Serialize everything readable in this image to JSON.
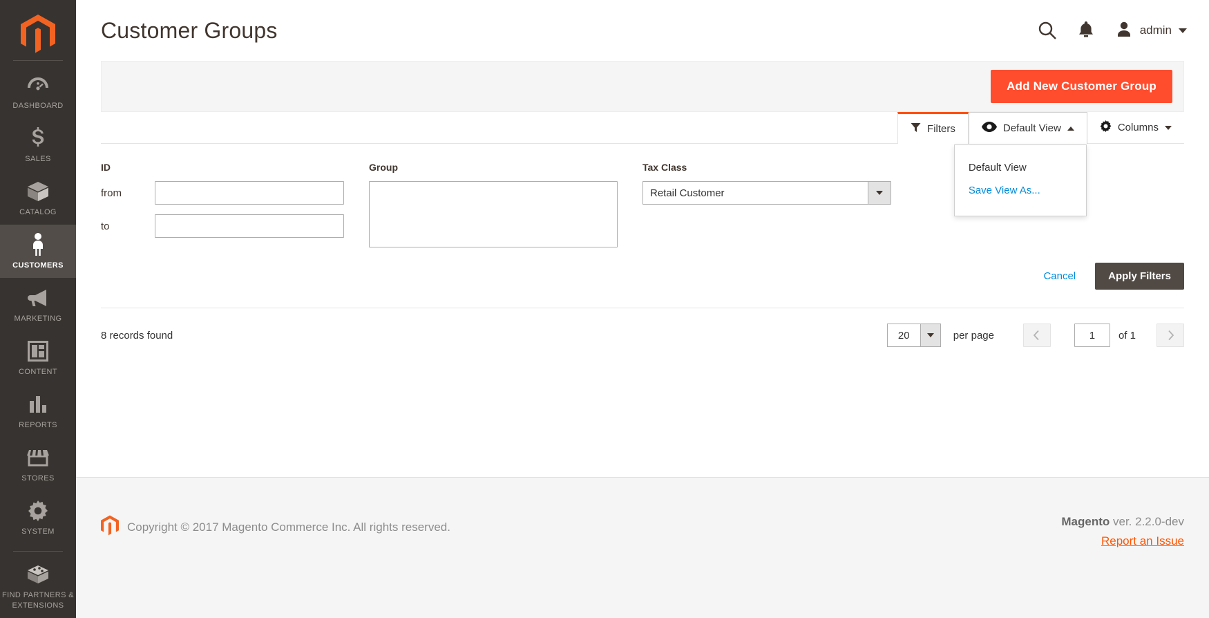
{
  "colors": {
    "accent_orange": "#ff4d2e",
    "sidebar_bg": "#373330",
    "link_blue": "#008bdb",
    "dark_button": "#514943",
    "active_tab_border": "#ff5003",
    "footer_link": "#ff5501"
  },
  "sidebar": {
    "logo_name": "magento-logo-icon",
    "items": [
      {
        "label": "DASHBOARD",
        "icon": "dashboard-gauge-icon",
        "active": false
      },
      {
        "label": "SALES",
        "icon": "dollar-sign-icon",
        "active": false
      },
      {
        "label": "CATALOG",
        "icon": "box-icon",
        "active": false
      },
      {
        "label": "CUSTOMERS",
        "icon": "person-icon",
        "active": true
      },
      {
        "label": "MARKETING",
        "icon": "megaphone-icon",
        "active": false
      },
      {
        "label": "CONTENT",
        "icon": "layout-page-icon",
        "active": false
      },
      {
        "label": "REPORTS",
        "icon": "bar-chart-icon",
        "active": false
      },
      {
        "label": "STORES",
        "icon": "storefront-icon",
        "active": false
      },
      {
        "label": "SYSTEM",
        "icon": "gear-icon",
        "active": false
      },
      {
        "label": "FIND PARTNERS & EXTENSIONS",
        "icon": "puzzle-box-icon",
        "active": false
      }
    ]
  },
  "header": {
    "title": "Customer Groups",
    "search_icon": "search-icon",
    "notifications_icon": "bell-icon",
    "avatar_icon": "user-avatar-icon",
    "admin_name": "admin",
    "caret_icon": "chevron-down-icon"
  },
  "page_actions": {
    "add_button_label": "Add New Customer Group"
  },
  "toolbar": {
    "filters": {
      "label": "Filters",
      "icon": "filter-funnel-icon",
      "active": true
    },
    "view": {
      "label": "Default View",
      "icon": "eye-icon",
      "caret": "chevron-up-icon",
      "expanded": true,
      "options": [
        {
          "label": "Default View",
          "type": "option"
        },
        {
          "label": "Save View As...",
          "type": "link"
        }
      ]
    },
    "columns": {
      "label": "Columns",
      "icon": "gear-icon",
      "caret": "chevron-down-icon"
    }
  },
  "filters": {
    "id": {
      "label": "ID",
      "from_label": "from",
      "from_value": "",
      "from_placeholder": "",
      "to_label": "to",
      "to_value": "",
      "to_placeholder": ""
    },
    "group": {
      "label": "Group",
      "value": "",
      "placeholder": ""
    },
    "tax_class": {
      "label": "Tax Class",
      "selected": "Retail Customer",
      "dropdown_icon": "chevron-down-icon"
    },
    "cancel_label": "Cancel",
    "apply_label": "Apply Filters"
  },
  "grid": {
    "records_found": "8 records found",
    "per_page_value": "20",
    "per_page_label": "per page",
    "prev_icon": "chevron-left-icon",
    "next_icon": "chevron-right-icon",
    "page_value": "1",
    "page_of": "of 1"
  },
  "footer": {
    "logo_icon": "magento-logo-small-icon",
    "copyright": "Copyright © 2017 Magento Commerce Inc. All rights reserved.",
    "brand": "Magento",
    "version": " ver. 2.2.0-dev",
    "report_link": "Report an Issue"
  }
}
